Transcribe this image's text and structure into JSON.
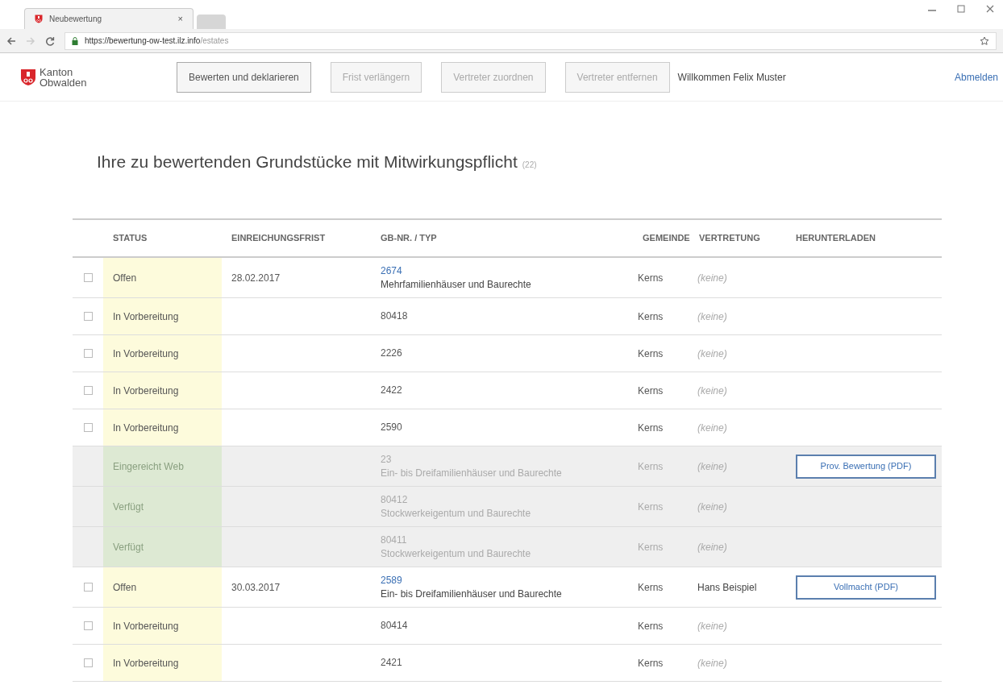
{
  "browser": {
    "tabs": [
      {
        "title": "Neubewertung",
        "close": "×",
        "selected": true
      },
      {
        "selected": false
      }
    ],
    "url_host": "https://bewertung-ow-test.ilz.info",
    "url_path": "/estates"
  },
  "header": {
    "logo_line1": "Kanton",
    "logo_line2": "Obwalden",
    "buttons": [
      {
        "label": "Bewerten und deklarieren",
        "disabled": false
      },
      {
        "label": "Frist verlängern",
        "disabled": true
      },
      {
        "label": "Vertreter zuordnen",
        "disabled": true
      },
      {
        "label": "Vertreter entfernen",
        "disabled": true
      }
    ],
    "welcome": "Willkommen Felix Muster",
    "logout": "Abmelden"
  },
  "title": "Ihre zu bewertenden Grundstücke mit Mitwirkungspflicht",
  "count": "(22)",
  "table": {
    "columns": [
      "STATUS",
      "EINREICHUNGSFRIST",
      "GB-NR. / TYP",
      "GEMEINDE",
      "VERTRETUNG",
      "HERUNTERLADEN"
    ],
    "rows": [
      {
        "kind": "active",
        "checked": false,
        "status": "Offen",
        "deadline": "28.02.2017",
        "gb": "2674",
        "type": "Mehrfamilienhäuser und Baurechte",
        "gemeinde": "Kerns",
        "vertretung": "(keine)",
        "has_rep": false
      },
      {
        "kind": "active",
        "checked": false,
        "status": "In Vorbereitung",
        "gb": "80418",
        "gemeinde": "Kerns",
        "vertretung": "(keine)",
        "has_rep": false
      },
      {
        "kind": "active",
        "checked": false,
        "status": "In Vorbereitung",
        "gb": "2226",
        "gemeinde": "Kerns",
        "vertretung": "(keine)",
        "has_rep": false
      },
      {
        "kind": "active",
        "checked": false,
        "status": "In Vorbereitung",
        "gb": "2422",
        "gemeinde": "Kerns",
        "vertretung": "(keine)",
        "has_rep": false
      },
      {
        "kind": "active",
        "checked": false,
        "status": "In Vorbereitung",
        "gb": "2590",
        "gemeinde": "Kerns",
        "vertretung": "(keine)",
        "has_rep": false
      },
      {
        "kind": "done",
        "status": "Eingereicht Web",
        "gb": "23",
        "type": "Ein- bis Dreifamilienhäuser und Baurechte",
        "gemeinde": "Kerns",
        "vertretung": "(keine)",
        "has_rep": false,
        "download": "Prov. Bewertung (PDF)"
      },
      {
        "kind": "done",
        "status": "Verfügt",
        "gb": "80412",
        "type": "Stockwerkeigentum und Baurechte",
        "gemeinde": "Kerns",
        "vertretung": "(keine)",
        "has_rep": false
      },
      {
        "kind": "done",
        "status": "Verfügt",
        "gb": "80411",
        "type": "Stockwerkeigentum und Baurechte",
        "gemeinde": "Kerns",
        "vertretung": "(keine)",
        "has_rep": false
      },
      {
        "kind": "active",
        "checked": false,
        "status": "Offen",
        "deadline": "30.03.2017",
        "gb": "2589",
        "type": "Ein- bis Dreifamilienhäuser und Baurechte",
        "gemeinde": "Kerns",
        "vertretung": "Hans Beispiel",
        "has_rep": true,
        "download": "Vollmacht (PDF)"
      },
      {
        "kind": "active",
        "checked": false,
        "status": "In Vorbereitung",
        "gb": "80414",
        "gemeinde": "Kerns",
        "vertretung": "(keine)",
        "has_rep": false
      },
      {
        "kind": "active",
        "checked": false,
        "status": "In Vorbereitung",
        "gb": "2421",
        "gemeinde": "Kerns",
        "vertretung": "(keine)",
        "has_rep": false
      }
    ]
  }
}
